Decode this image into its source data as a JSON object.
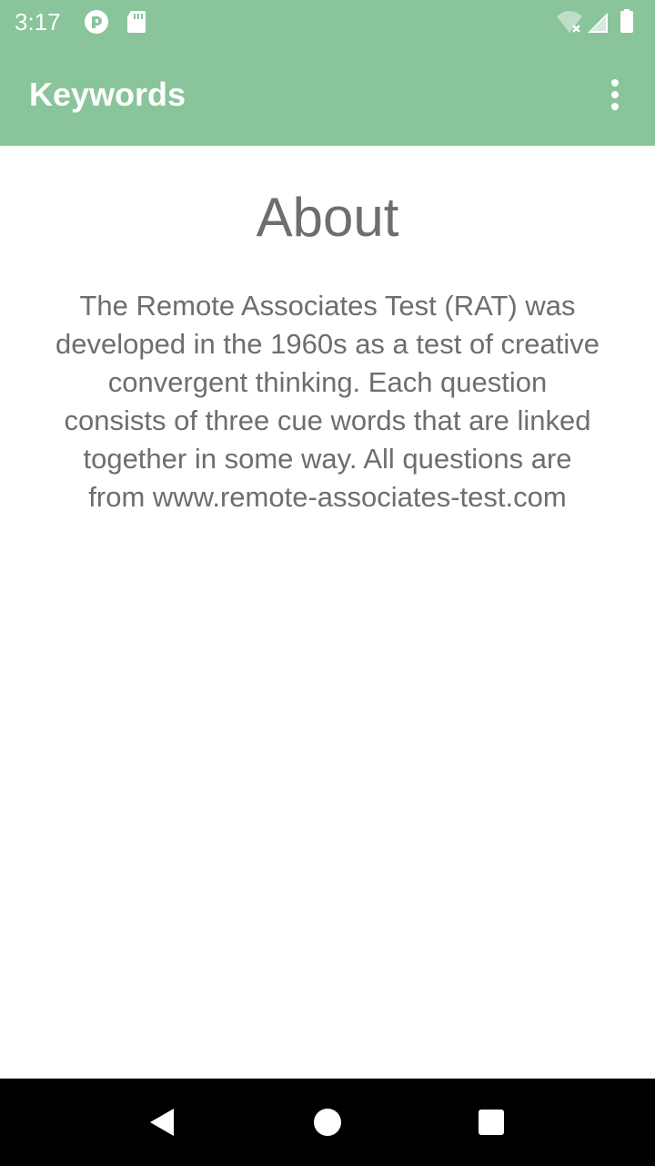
{
  "status_bar": {
    "time": "3:17",
    "left_icons": [
      "pocket-casts-icon",
      "sd-card-icon"
    ],
    "right_icons": [
      "wifi-off-icon",
      "cell-signal-icon",
      "battery-full-icon"
    ],
    "background": "#89c49a"
  },
  "app_bar": {
    "title": "Keywords",
    "overflow_icon": "more-vert-icon",
    "background": "#89c49a"
  },
  "about": {
    "heading": "About",
    "body": "The Remote Associates Test (RAT) was developed in the 1960s as a test of creative convergent thinking. Each question consists of three cue words that are linked together in some way. All questions are from www.remote-associates-test.com"
  },
  "nav_bar": {
    "buttons": [
      "back-icon",
      "home-icon",
      "recents-icon"
    ]
  }
}
